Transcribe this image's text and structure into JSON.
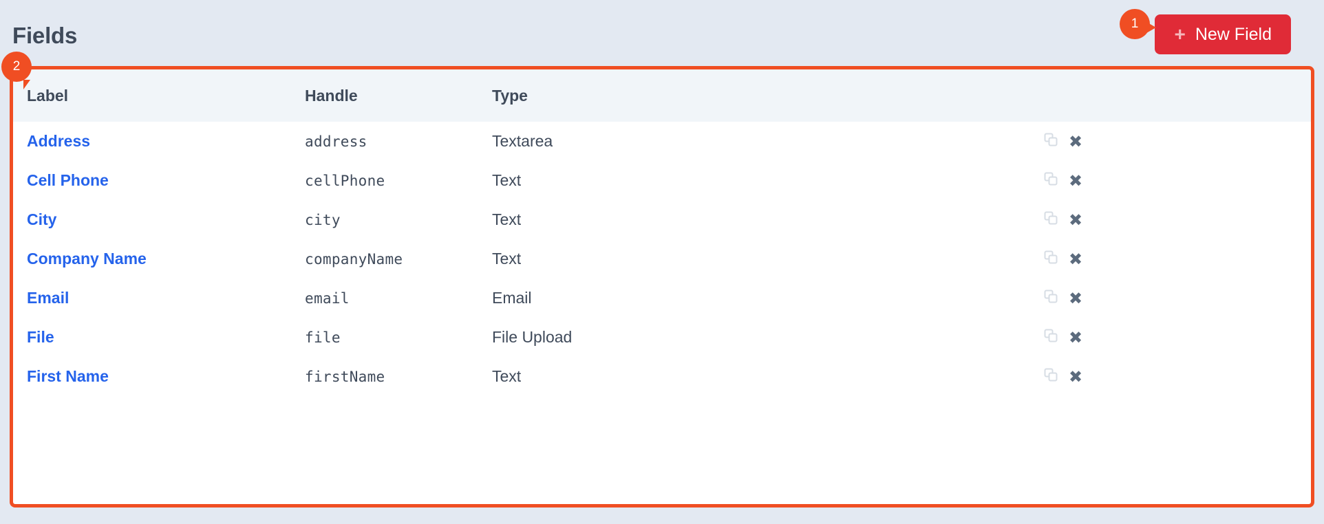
{
  "header": {
    "title": "Fields",
    "new_field_button": {
      "label": "New Field",
      "plus_icon": "plus-icon",
      "color": "#e02b37"
    }
  },
  "annotations": [
    {
      "id": "1",
      "label": "1",
      "target": "new-field-button",
      "color": "#f04e23"
    },
    {
      "id": "2",
      "label": "2",
      "target": "fields-table",
      "color": "#f04e23"
    }
  ],
  "table": {
    "columns": [
      "Label",
      "Handle",
      "Type",
      ""
    ],
    "row_actions": {
      "copy_icon": "copy-icon",
      "delete_icon": "close-icon",
      "delete_glyph": "✖"
    },
    "rows": [
      {
        "label": "Address",
        "handle": "address",
        "type": "Textarea"
      },
      {
        "label": "Cell Phone",
        "handle": "cellPhone",
        "type": "Text"
      },
      {
        "label": "City",
        "handle": "city",
        "type": "Text"
      },
      {
        "label": "Company Name",
        "handle": "companyName",
        "type": "Text"
      },
      {
        "label": "Email",
        "handle": "email",
        "type": "Email"
      },
      {
        "label": "File",
        "handle": "file",
        "type": "File Upload"
      },
      {
        "label": "First Name",
        "handle": "firstName",
        "type": "Text"
      }
    ]
  },
  "colors": {
    "page_background": "#e3e9f2",
    "panel_border": "#f04e23",
    "link": "#2563eb",
    "text": "#3f4a5a",
    "table_header_background": "#f1f5f9"
  }
}
